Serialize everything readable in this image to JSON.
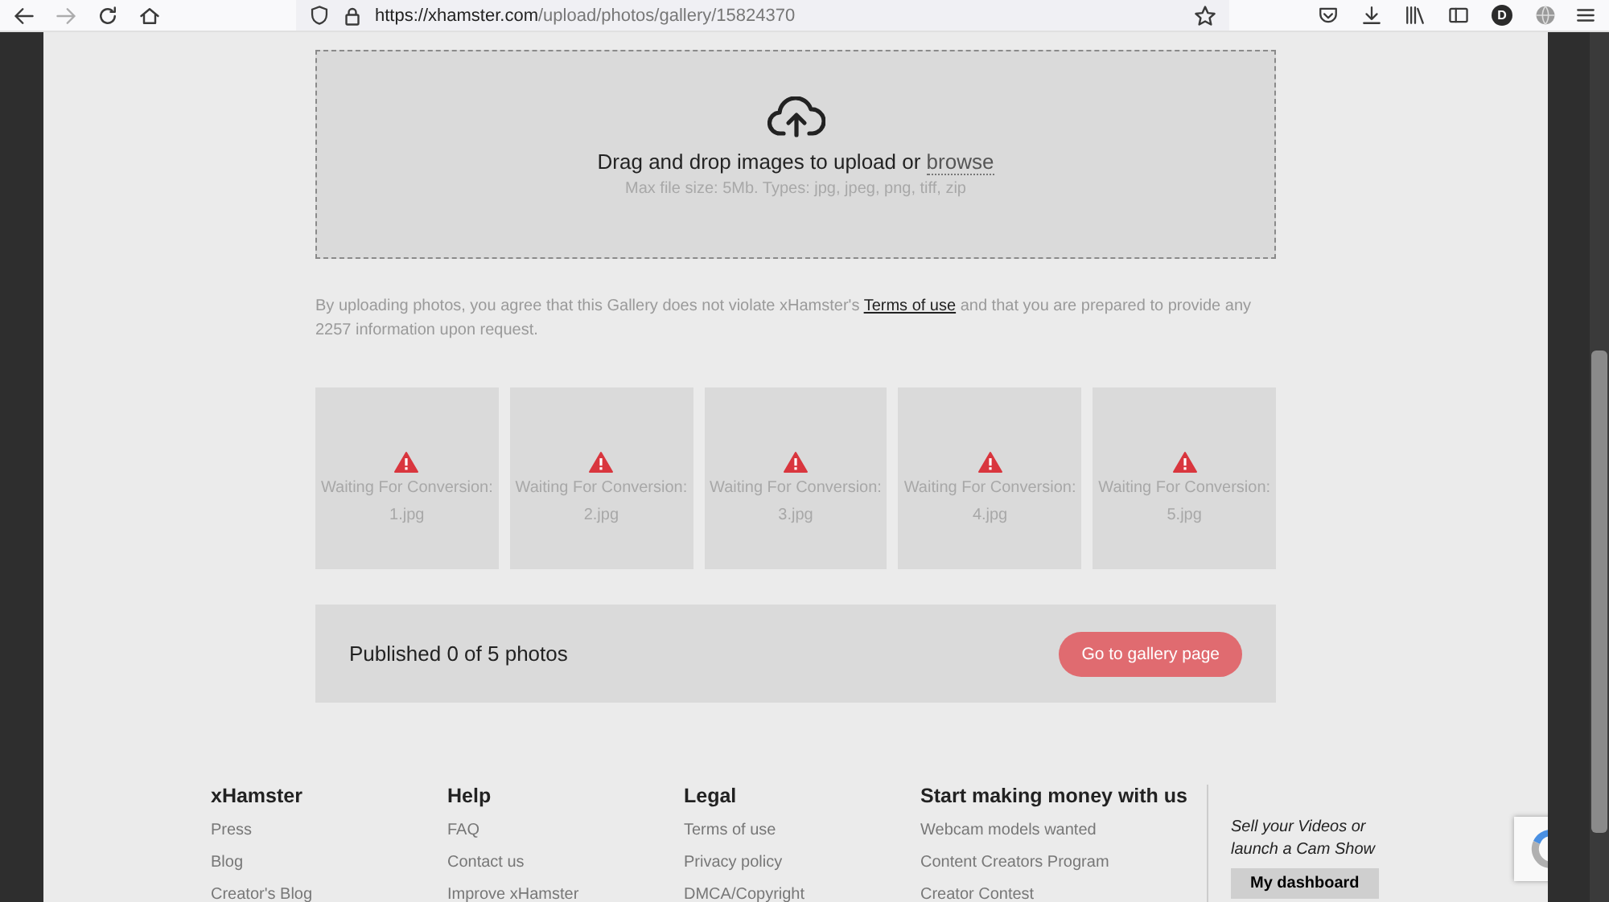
{
  "browser": {
    "url_host": "https://xhamster.com",
    "url_path": "/upload/photos/gallery/15824370",
    "profile_initial": "D"
  },
  "upload": {
    "prompt": "Drag and drop images to upload or",
    "browse": "browse",
    "hint": "Max file size: 5Mb. Types: jpg, jpeg, png, tiff, zip"
  },
  "agreement": {
    "before": "By uploading photos, you agree that this Gallery does not violate xHamster's",
    "link": "Terms of use",
    "after": "and that you are prepared to provide any 2257 information upon request."
  },
  "photos": [
    {
      "status": "Waiting For Conversion:",
      "file": "1.jpg"
    },
    {
      "status": "Waiting For Conversion:",
      "file": "2.jpg"
    },
    {
      "status": "Waiting For Conversion:",
      "file": "3.jpg"
    },
    {
      "status": "Waiting For Conversion:",
      "file": "4.jpg"
    },
    {
      "status": "Waiting For Conversion:",
      "file": "5.jpg"
    }
  ],
  "publish_bar": {
    "text": "Published 0 of 5 photos",
    "button": "Go to gallery page"
  },
  "footer": {
    "columns": [
      {
        "title": "xHamster",
        "links": [
          "Press",
          "Blog",
          "Creator's Blog"
        ]
      },
      {
        "title": "Help",
        "links": [
          "FAQ",
          "Contact us",
          "Improve xHamster"
        ]
      },
      {
        "title": "Legal",
        "links": [
          "Terms of use",
          "Privacy policy",
          "DMCA/Copyright"
        ]
      },
      {
        "title": "Start making money with us",
        "links": [
          "Webcam models wanted",
          "Content Creators Program",
          "Creator Contest"
        ]
      }
    ],
    "promo": {
      "text": "Sell your Videos or launch a Cam Show",
      "button": "My dashboard"
    }
  }
}
